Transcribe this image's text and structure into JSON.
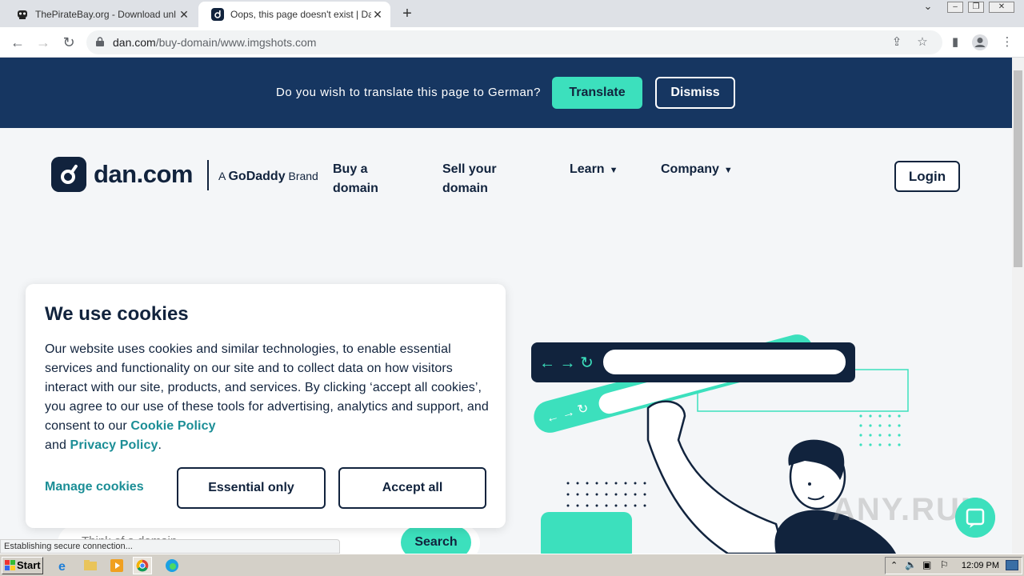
{
  "browser": {
    "tabs": [
      {
        "title": "ThePirateBay.org - Download unlimit",
        "active": false
      },
      {
        "title": "Oops, this page doesn't exist | Dan.c",
        "active": true
      }
    ],
    "url_host": "dan.com",
    "url_path": "/buy-domain/www.imgshots.com"
  },
  "translate": {
    "message": "Do you wish to translate this page to German?",
    "translate_label": "Translate",
    "dismiss_label": "Dismiss"
  },
  "header": {
    "logo_text": "dan.com",
    "brand_prefix": "A",
    "brand_name": "GoDaddy",
    "brand_suffix": "Brand",
    "nav": {
      "buy_line1": "Buy a",
      "buy_line2": "domain",
      "sell_line1": "Sell your",
      "sell_line2": "domain",
      "learn": "Learn",
      "company": "Company"
    },
    "login_label": "Login"
  },
  "search": {
    "placeholder": "Think of a domain...",
    "button_label": "Search"
  },
  "cookie": {
    "title": "We use cookies",
    "body_part1": "Our website uses cookies and similar technologies, to enable essential services and functionality on our site and to collect data on how visitors interact with our site, products, and services. By clicking ‘accept all cookies’, you agree to our use of these tools for advertising, analytics and support, and consent to our ",
    "cookie_policy": "Cookie Policy",
    "body_part2": " and ",
    "privacy_policy": "Privacy Policy",
    "body_end": ".",
    "manage_label": "Manage cookies",
    "essential_label": "Essential only",
    "accept_label": "Accept all"
  },
  "status_text": "Establishing secure connection...",
  "watermark": "ANY.RUN",
  "taskbar": {
    "start_label": "Start",
    "clock": "12:09 PM"
  },
  "colors": {
    "navy": "#11233d",
    "banner": "#163661",
    "accent": "#3ce0bd",
    "link": "#1b8e96"
  }
}
